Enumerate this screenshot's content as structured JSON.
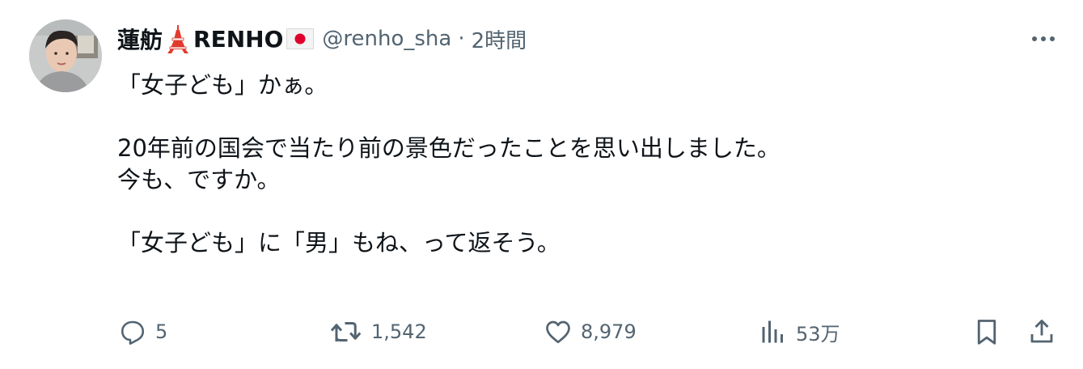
{
  "author": {
    "name": "蓮舫",
    "name_suffix": "RENHO",
    "handle": "@renho_sha",
    "separator": "·",
    "time": "2時間",
    "avatar_icon": "profile-photo",
    "name_emojis": [
      "tokyo-tower-icon",
      "japan-flag-icon"
    ]
  },
  "tweet": {
    "lines": [
      "「女子ども」かぁ。",
      "",
      "20年前の国会で当たり前の景色だったことを思い出しました。",
      "今も、ですか。",
      "",
      "「女子ども」に「男」もね、って返そう。"
    ]
  },
  "actions": {
    "reply": {
      "icon": "reply-icon",
      "count": "5"
    },
    "retweet": {
      "icon": "retweet-icon",
      "count": "1,542"
    },
    "like": {
      "icon": "heart-icon",
      "count": "8,979"
    },
    "views": {
      "icon": "views-icon",
      "count": "53万"
    },
    "bookmark": {
      "icon": "bookmark-icon"
    },
    "share": {
      "icon": "share-icon"
    }
  },
  "colors": {
    "text_primary": "#0f1419",
    "text_secondary": "#536471",
    "flag_red": "#e0002b",
    "tower_red": "#e23a2e"
  }
}
